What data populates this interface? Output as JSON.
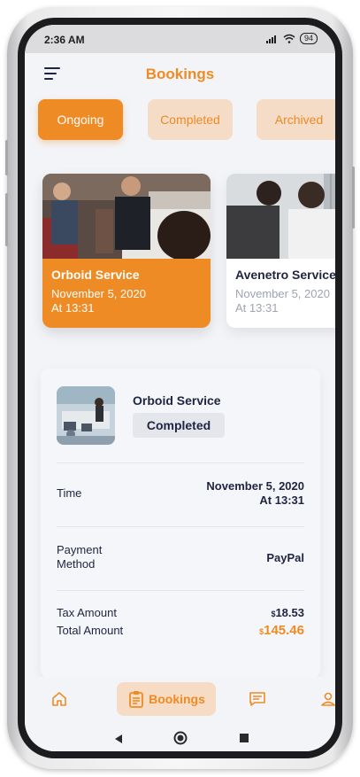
{
  "status_bar": {
    "time": "2:36 AM",
    "battery": "94"
  },
  "header": {
    "title": "Bookings",
    "menu_icon": "menu-icon"
  },
  "tabs": [
    {
      "label": "Ongoing",
      "active": true
    },
    {
      "label": "Completed",
      "active": false
    },
    {
      "label": "Archived",
      "active": false
    }
  ],
  "service_cards": [
    {
      "name": "Orboid Service",
      "date": "November 5, 2020",
      "time": "At 13:31"
    },
    {
      "name": "Avenetro Service",
      "date": "November 5, 2020",
      "time": "At 13:31"
    }
  ],
  "detail": {
    "service_name": "Orboid Service",
    "status": "Completed",
    "time_label": "Time",
    "time_value_date": "November 5, 2020",
    "time_value_time": "At 13:31",
    "payment_label_1": "Payment",
    "payment_label_2": "Method",
    "payment_value": "PayPal",
    "tax_label": "Tax Amount",
    "tax_currency": "$",
    "tax_value": "18.53",
    "total_label": "Total Amount",
    "total_currency": "$",
    "total_value": "145.46"
  },
  "bottom_nav": {
    "active_label": "Bookings"
  },
  "colors": {
    "accent": "#ef8b25",
    "accent_light": "#f4dcc7",
    "dark_text": "#1f2440",
    "muted_text": "#9fa4b3"
  }
}
